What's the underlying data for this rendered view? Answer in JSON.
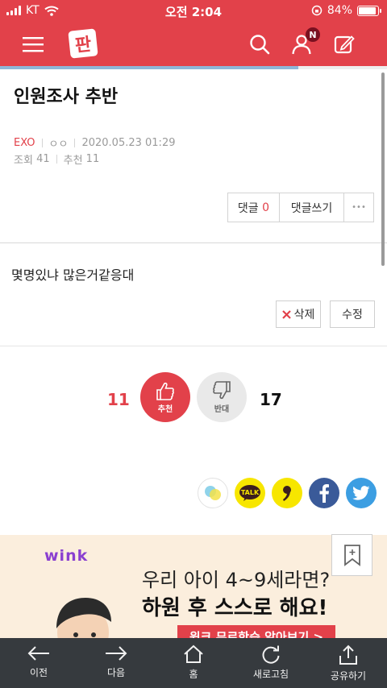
{
  "status_bar": {
    "carrier": "KT",
    "time": "오전 2:04",
    "battery_percent": "84%",
    "battery_level": 0.84
  },
  "header": {
    "logo_text": "판",
    "menu_icon": "hamburger-icon",
    "search_icon": "search-icon",
    "user_icon": "user-icon",
    "user_badge": "N",
    "write_icon": "pencil-icon",
    "brand_color": "#e2414a",
    "reading_progress": 0.77
  },
  "post": {
    "title": "인원조사 추반",
    "category": "EXO",
    "author": "ㅇㅇ",
    "date": "2020.05.23 01:29",
    "views_label": "조회",
    "views": "41",
    "recommend_label": "추천",
    "recommend": "11",
    "body": "몇명있냐 많은거같응대"
  },
  "actions": {
    "comment_label": "댓글",
    "comment_count": "0",
    "write_comment_label": "댓글쓰기",
    "more_label": "•••",
    "delete_label": "삭제",
    "edit_label": "수정"
  },
  "vote": {
    "up_count": "11",
    "up_label": "추천",
    "down_label": "반대",
    "down_count": "17"
  },
  "share_icons": [
    "story-icon",
    "kakaotalk-icon",
    "comma-icon",
    "facebook-icon",
    "twitter-icon"
  ],
  "share": {
    "talk_label": "TALK"
  },
  "ad": {
    "brand": "wink",
    "line1": "우리 아이 4~9세라면?",
    "line2": "하원 후 스스로 해요!",
    "cta": "윙크 무료학습 알아보기 >"
  },
  "bottom_nav": [
    {
      "label": "이전",
      "icon": "arrow-left-icon"
    },
    {
      "label": "다음",
      "icon": "arrow-right-icon"
    },
    {
      "label": "홈",
      "icon": "home-icon"
    },
    {
      "label": "새로고침",
      "icon": "refresh-icon"
    },
    {
      "label": "공유하기",
      "icon": "share-icon"
    }
  ]
}
